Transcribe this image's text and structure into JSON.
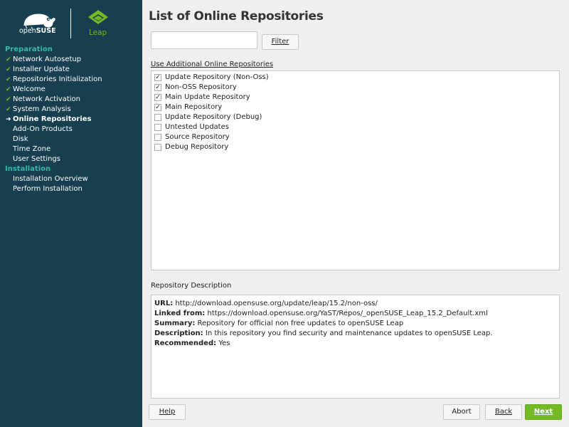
{
  "branding": {
    "opensuse_prefix": "open",
    "opensuse_suffix": "SUSE",
    "leap": "Leap",
    "colors": {
      "sidebar_bg": "#173f4f",
      "accent_green": "#73ba25",
      "group_teal": "#35b9ab"
    }
  },
  "sidebar": {
    "groups": [
      {
        "label": "Preparation",
        "steps": [
          {
            "label": "Network Autosetup",
            "state": "done",
            "mark": "✔"
          },
          {
            "label": "Installer Update",
            "state": "done",
            "mark": "✔"
          },
          {
            "label": "Repositories Initialization",
            "state": "done",
            "mark": "✔"
          },
          {
            "label": "Welcome",
            "state": "done",
            "mark": "✔"
          },
          {
            "label": "Network Activation",
            "state": "done",
            "mark": "✔"
          },
          {
            "label": "System Analysis",
            "state": "done",
            "mark": "✔"
          },
          {
            "label": "Online Repositories",
            "state": "current",
            "mark": "➜"
          },
          {
            "label": "Add-On Products",
            "state": "pending",
            "mark": ""
          },
          {
            "label": "Disk",
            "state": "pending",
            "mark": ""
          },
          {
            "label": "Time Zone",
            "state": "pending",
            "mark": ""
          },
          {
            "label": "User Settings",
            "state": "pending",
            "mark": ""
          }
        ]
      },
      {
        "label": "Installation",
        "steps": [
          {
            "label": "Installation Overview",
            "state": "pending",
            "mark": ""
          },
          {
            "label": "Perform Installation",
            "state": "pending",
            "mark": ""
          }
        ]
      }
    ]
  },
  "main": {
    "title": "List of Online Repositories",
    "filter": {
      "value": "",
      "button_label": "Filter"
    },
    "repos_label": "Use Additional Online Repositories",
    "repos": [
      {
        "label": "Update Repository (Non-Oss)",
        "checked": true
      },
      {
        "label": "Non-OSS Repository",
        "checked": true
      },
      {
        "label": "Main Update Repository",
        "checked": true
      },
      {
        "label": "Main Repository",
        "checked": true
      },
      {
        "label": "Update Repository (Debug)",
        "checked": false
      },
      {
        "label": "Untested Updates",
        "checked": false
      },
      {
        "label": "Source Repository",
        "checked": false
      },
      {
        "label": "Debug Repository",
        "checked": false
      }
    ],
    "description_label": "Repository Description",
    "description": {
      "url_key": "URL:",
      "url": "http://download.opensuse.org/update/leap/15.2/non-oss/",
      "linked_key": "Linked from:",
      "linked": "https://download.opensuse.org/YaST/Repos/_openSUSE_Leap_15.2_Default.xml",
      "summary_key": "Summary:",
      "summary": "Repository for official non free updates to openSUSE Leap",
      "description_key": "Description:",
      "description": "In this repository you find security and maintenance updates to openSUSE Leap.",
      "recommended_key": "Recommended:",
      "recommended": "Yes"
    }
  },
  "buttons": {
    "help": "Help",
    "abort": "Abort",
    "back": "Back",
    "next": "Next"
  }
}
